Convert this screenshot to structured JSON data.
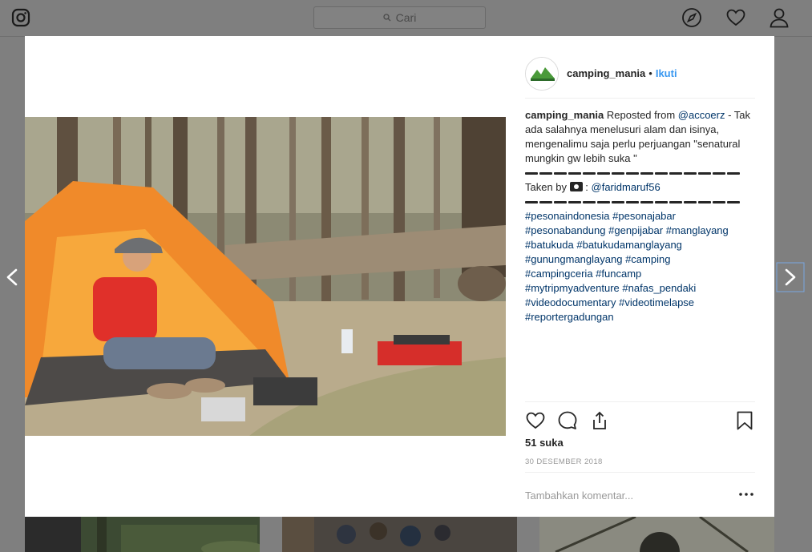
{
  "search": {
    "placeholder": "Cari"
  },
  "post": {
    "username": "camping_mania",
    "follow_label": "Ikuti",
    "caption": {
      "username": "camping_mania",
      "text_before_mention": "Reposted from ",
      "mention": "@accoerz",
      "text_after_mention": " - Tak ada salahnya menelusuri alam dan isinya, mengenalimu saja perlu perjuangan \"senatural mungkin gw lebih suka \"",
      "taken_by": "Taken by",
      "photographer": "@faridmaruf56",
      "hashtags": [
        "#pesonaindonesia",
        "#pesonajabar",
        "#pesonabandung",
        "#genpijabar",
        "#manglayang",
        "#batukuda",
        "#batukudamanglayang",
        "#gunungmanglayang",
        "#camping",
        "#campingceria",
        "#funcamp",
        "#mytripmyadventure",
        "#nafas_pendaki",
        "#videodocumentary",
        "#videotimelapse",
        "#reportergadungan"
      ]
    },
    "likes": "51 suka",
    "date": "30 DESEMBER 2018",
    "comment_placeholder": "Tambahkan komentar...",
    "more_label": "..."
  },
  "icons": {
    "logo": "instagram-icon",
    "explore": "compass-icon",
    "activity": "heart-icon",
    "profile": "user-icon",
    "like": "heart-outline-icon",
    "comment": "comment-icon",
    "share": "share-icon",
    "save": "bookmark-icon",
    "prev": "chevron-left-icon",
    "next": "chevron-right-icon"
  },
  "colors": {
    "link": "#003569",
    "follow": "#3897f0",
    "overlay": "#7f7f7f"
  }
}
